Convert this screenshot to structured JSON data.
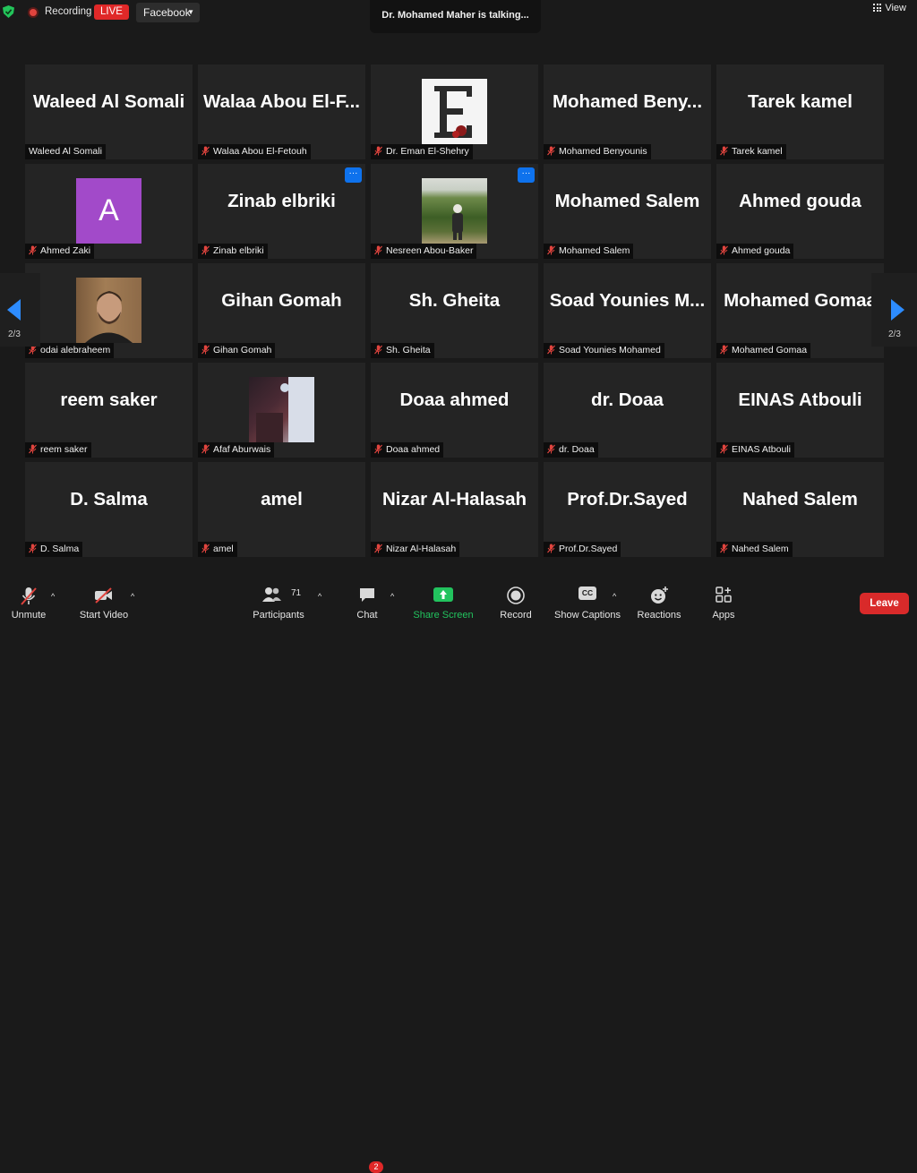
{
  "topbar": {
    "recording_label": "Recording",
    "live_label": "LIVE",
    "stream_target": "Facebook",
    "talking_text": "Dr. Mohamed Maher is talking...",
    "view_label": "View"
  },
  "colors": {
    "accent": "#2d8cff",
    "live": "#e02828",
    "share_green": "#22c35e",
    "leave": "#d92a2a",
    "avatar_a": "#a24ac9"
  },
  "pagination": {
    "left": "2/3",
    "right": "2/3"
  },
  "tiles": [
    {
      "big": "Waleed Al Somali",
      "tag": "Waleed Al Somali",
      "muted": false
    },
    {
      "big": "Walaa Abou El-F...",
      "tag": "Walaa Abou El-Fetouh",
      "muted": true
    },
    {
      "big": "",
      "tag": "Dr. Eman El-Shehry",
      "muted": true,
      "image": "letter-e-logo"
    },
    {
      "big": "Mohamed Beny...",
      "tag": "Mohamed Benyounis",
      "muted": true
    },
    {
      "big": "Tarek kamel",
      "tag": "Tarek kamel",
      "muted": true
    },
    {
      "big": "",
      "tag": "Ahmed Zaki",
      "muted": true,
      "avatar_letter": "A"
    },
    {
      "big": "Zinab elbriki",
      "tag": "Zinab elbriki",
      "muted": true,
      "more": "···"
    },
    {
      "big": "",
      "tag": "Nesreen Abou-Baker",
      "muted": true,
      "image": "garden-photo",
      "more": "···"
    },
    {
      "big": "Mohamed Salem",
      "tag": "Mohamed Salem",
      "muted": true
    },
    {
      "big": "Ahmed gouda",
      "tag": "Ahmed gouda",
      "muted": true
    },
    {
      "big": "",
      "tag": "odai alebraheem",
      "muted": true,
      "image": "man-portrait"
    },
    {
      "big": "Gihan Gomah",
      "tag": "Gihan Gomah",
      "muted": true
    },
    {
      "big": "Sh. Gheita",
      "tag": "Sh. Gheita",
      "muted": true
    },
    {
      "big": "Soad Younies M...",
      "tag": "Soad Younies Mohamed",
      "muted": true
    },
    {
      "big": "Mohamed Gomaa",
      "tag": "Mohamed Gomaa",
      "muted": true
    },
    {
      "big": "reem saker",
      "tag": "reem saker",
      "muted": true
    },
    {
      "big": "",
      "tag": "Afaf Aburwais",
      "muted": true,
      "image": "dark-room-photo"
    },
    {
      "big": "Doaa ahmed",
      "tag": "Doaa ahmed",
      "muted": true
    },
    {
      "big": "dr. Doaa",
      "tag": "dr. Doaa",
      "muted": true
    },
    {
      "big": "EINAS Atbouli",
      "tag": "EINAS Atbouli",
      "muted": true
    },
    {
      "big": "D. Salma",
      "tag": "D. Salma",
      "muted": true
    },
    {
      "big": "amel",
      "tag": "amel",
      "muted": true
    },
    {
      "big": "Nizar Al-Halasah",
      "tag": "Nizar Al-Halasah",
      "muted": true
    },
    {
      "big": "Prof.Dr.Sayed",
      "tag": "Prof.Dr.Sayed",
      "muted": true
    },
    {
      "big": "Nahed Salem",
      "tag": "Nahed Salem",
      "muted": true
    }
  ],
  "toolbar": {
    "unmute": "Unmute",
    "start_video": "Start Video",
    "participants": "Participants",
    "participants_count": "71",
    "chat": "Chat",
    "chat_badge": "2",
    "share_screen": "Share Screen",
    "record": "Record",
    "show_captions": "Show Captions",
    "captions_icon_text": "CC",
    "reactions": "Reactions",
    "apps": "Apps",
    "leave": "Leave"
  }
}
